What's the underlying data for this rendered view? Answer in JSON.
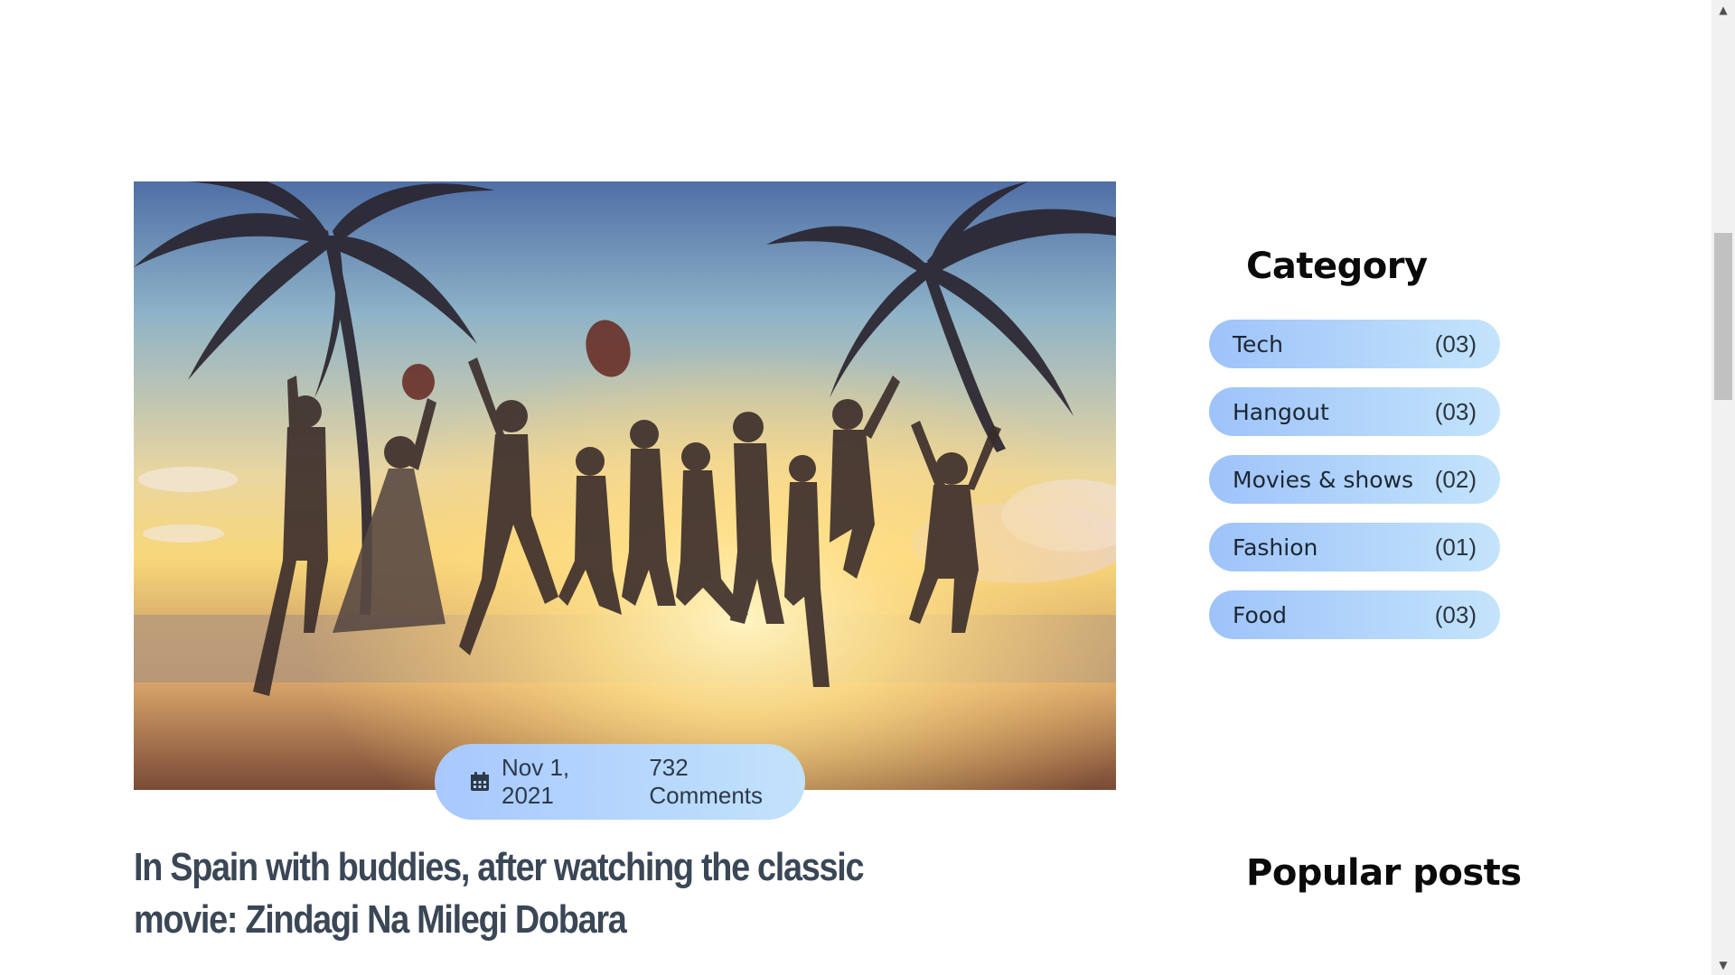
{
  "post": {
    "image_alt": "Friends jumping on a beach at sunset under palm trees",
    "date": "Nov 1, 2021",
    "comments": "732 Comments",
    "title": "In Spain with buddies, after watching the classic movie: Zindagi Na Milegi Dobara",
    "icons": {
      "calendar": "calendar-icon"
    }
  },
  "sidebar": {
    "category_title": "Category",
    "categories": [
      {
        "label": "Tech",
        "count": "(03)"
      },
      {
        "label": "Hangout",
        "count": "(03)"
      },
      {
        "label": "Movies & shows",
        "count": "(02)"
      },
      {
        "label": "Fashion",
        "count": "(01)"
      },
      {
        "label": "Food",
        "count": "(03)"
      }
    ],
    "popular_title": "Popular posts"
  },
  "colors": {
    "pill_start": "#9ec3fa",
    "pill_end": "#c4e4fb",
    "title_text": "#3b4756"
  }
}
